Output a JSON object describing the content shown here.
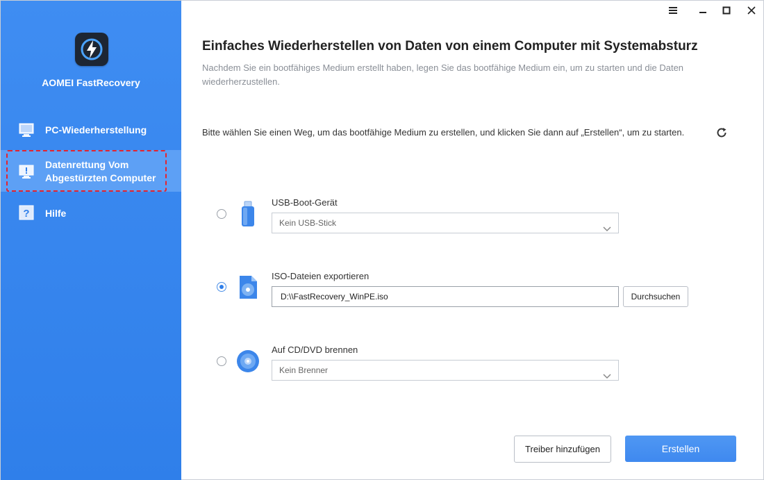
{
  "app": {
    "name": "AOMEI FastRecovery"
  },
  "sidebar": {
    "items": [
      {
        "label": "PC-Wiederherstellung",
        "icon": "monitor-icon",
        "selected": false
      },
      {
        "label": "Datenrettung Vom\nAbgestürzten Computer",
        "icon": "monitor-warning-icon",
        "selected": true
      },
      {
        "label": "Hilfe",
        "icon": "help-icon",
        "selected": false
      }
    ]
  },
  "window_controls": [
    "menu-icon",
    "minimize-icon",
    "maximize-icon",
    "close-icon"
  ],
  "main": {
    "title": "Einfaches Wiederherstellen von Daten von einem Computer mit Systemabsturz",
    "description": "Nachdem Sie ein bootfähiges Medium erstellt haben, legen Sie das bootfähige Medium ein, um zu starten und die Daten wiederherzustellen.",
    "instruction": "Bitte wählen Sie einen Weg, um das bootfähige Medium zu erstellen, und klicken Sie dann auf „Erstellen“, um zu starten.",
    "options": [
      {
        "label": "USB-Boot-Gerät",
        "icon": "usb-drive-icon",
        "selected": false,
        "control": "select",
        "value": "Kein USB-Stick"
      },
      {
        "label": "ISO-Dateien exportieren",
        "icon": "iso-file-icon",
        "selected": true,
        "control": "input",
        "value": "D:\\\\FastRecovery_WinPE.iso",
        "button": "Durchsuchen"
      },
      {
        "label": "Auf CD/DVD brennen",
        "icon": "disc-icon",
        "selected": false,
        "control": "select",
        "value": "Kein Brenner"
      }
    ]
  },
  "footer": {
    "driver_button": "Treiber hinzufügen",
    "create_button": "Erstellen"
  },
  "colors": {
    "sidebar": "#3f8df2",
    "sidebar_selected": "#5da0f5",
    "primary_button": "#4a92f1",
    "highlight_dash": "#e6232c"
  }
}
